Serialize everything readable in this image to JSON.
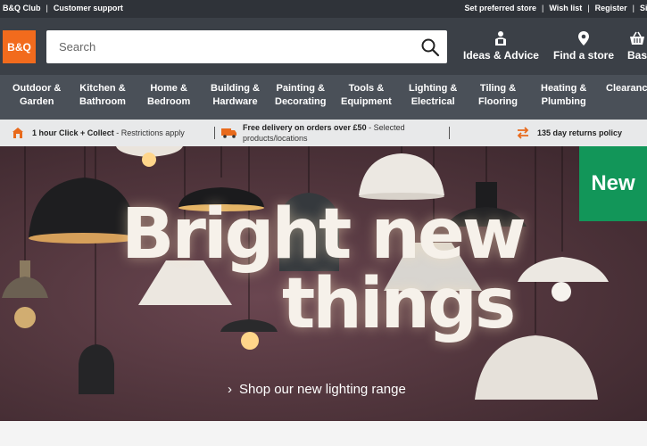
{
  "utility": {
    "club": "B&Q Club",
    "support": "Customer support",
    "preferred_store": "Set preferred store",
    "wishlist": "Wish list",
    "register": "Register",
    "signin": "Sig"
  },
  "header": {
    "logo": "B&Q",
    "search_placeholder": "Search",
    "ideas": "Ideas & Advice",
    "find_store": "Find a store",
    "basket": "Bas"
  },
  "nav": [
    {
      "line1": "Outdoor &",
      "line2": "Garden"
    },
    {
      "line1": "Kitchen &",
      "line2": "Bathroom"
    },
    {
      "line1": "Home &",
      "line2": "Bedroom"
    },
    {
      "line1": "Building &",
      "line2": "Hardware"
    },
    {
      "line1": "Painting &",
      "line2": "Decorating"
    },
    {
      "line1": "Tools &",
      "line2": "Equipment"
    },
    {
      "line1": "Lighting &",
      "line2": "Electrical"
    },
    {
      "line1": "Tiling &",
      "line2": "Flooring"
    },
    {
      "line1": "Heating &",
      "line2": "Plumbing"
    },
    {
      "line1": "Clearance",
      "line2": ""
    }
  ],
  "info": {
    "click_collect_bold": "1 hour Click + Collect",
    "click_collect_rest": " - Restrictions apply",
    "delivery_bold": "Free delivery on orders over £50",
    "delivery_rest": " - Selected",
    "delivery_rest2": "products/locations",
    "returns": "135 day returns policy"
  },
  "hero": {
    "badge": "New",
    "headline_line1": "Bright new",
    "headline_line2": "things",
    "cta": "Shop our new lighting range"
  },
  "colors": {
    "brand_orange": "#f26b1d",
    "new_badge_green": "#129659",
    "header_dark": "#3b4047"
  }
}
